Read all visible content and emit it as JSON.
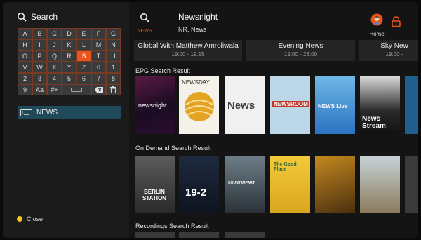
{
  "search_panel": {
    "title": "Search",
    "keys": [
      "A",
      "B",
      "C",
      "D",
      "E",
      "F",
      "G",
      "H",
      "I",
      "J",
      "K",
      "L",
      "M",
      "N",
      "O",
      "P",
      "Q",
      "R",
      "S",
      "T",
      "U",
      "V",
      "W",
      "X",
      "Y",
      "Z",
      "0",
      "1",
      "2",
      "3",
      "4",
      "5",
      "6",
      "7",
      "8",
      "9",
      "Aa",
      "#+"
    ],
    "selected_key": "S",
    "query": "NEWS",
    "close_label": "Close"
  },
  "header": {
    "search_label": "NEWS",
    "program_title": "Newsnight",
    "program_subtitle": "NR, News",
    "home_label": "Home"
  },
  "epg_strip": [
    {
      "title": "Global With Matthew Amroliwala",
      "time": "19:00 - 19:15"
    },
    {
      "title": "Evening News",
      "time": "19:00 - 23:00"
    },
    {
      "title": "Sky New",
      "time": "19:00 -"
    }
  ],
  "sections": {
    "epg": "EPG Search Result",
    "on_demand": "On Demand Search Result",
    "recordings": "Recordings Search Result"
  },
  "epg_posters": [
    "newsnight",
    "NEWSDAY",
    "News",
    "NEWSROOM",
    "NEWS Live",
    "News Stream"
  ],
  "ondemand_posters": [
    "BERLIN STATION",
    "19-2",
    "COUNTERPART",
    "The Good Place",
    "",
    "",
    ""
  ],
  "colors": {
    "accent": "#e8541b",
    "key_border": "#7a3a22",
    "pill": "#1f4a5a",
    "close_dot": "#f5c518"
  }
}
